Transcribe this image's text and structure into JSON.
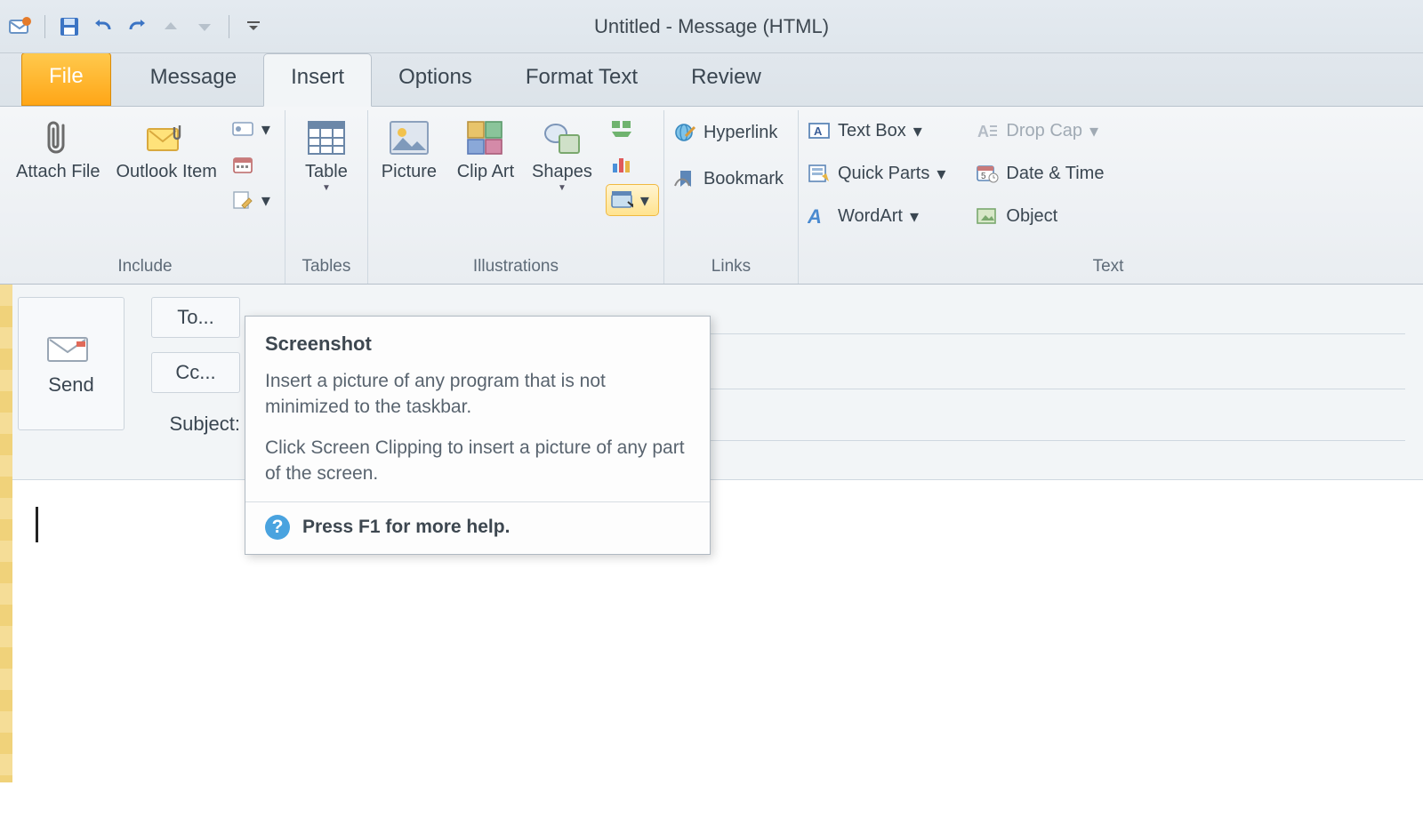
{
  "window": {
    "title": "Untitled  -  Message (HTML)"
  },
  "qat_icons": [
    "outlook-icon",
    "save-icon",
    "undo-icon",
    "redo-icon",
    "prev-icon",
    "next-icon",
    "customize-icon"
  ],
  "tabs": {
    "file": "File",
    "items": [
      "Message",
      "Insert",
      "Options",
      "Format Text",
      "Review"
    ],
    "active": "Insert"
  },
  "ribbon": {
    "groups": [
      {
        "name": "Include",
        "big": [
          {
            "id": "attach-file",
            "label": "Attach\nFile",
            "icon": "paperclip-icon"
          },
          {
            "id": "outlook-item",
            "label": "Outlook\nItem",
            "icon": "envelope-paperclip-icon"
          }
        ],
        "small": [
          {
            "id": "business-card",
            "icon": "business-card-icon",
            "dropdown": true
          },
          {
            "id": "calendar",
            "icon": "calendar-icon"
          },
          {
            "id": "signature",
            "icon": "signature-icon",
            "dropdown": true
          }
        ]
      },
      {
        "name": "Tables",
        "big": [
          {
            "id": "table",
            "label": "Table",
            "icon": "table-icon",
            "dropdown": true
          }
        ]
      },
      {
        "name": "Illustrations",
        "big": [
          {
            "id": "picture",
            "label": "Picture",
            "icon": "picture-icon"
          },
          {
            "id": "clip-art",
            "label": "Clip\nArt",
            "icon": "clipart-icon"
          },
          {
            "id": "shapes",
            "label": "Shapes",
            "icon": "shapes-icon",
            "dropdown": true
          }
        ],
        "small": [
          {
            "id": "smartart",
            "icon": "smartart-icon"
          },
          {
            "id": "chart",
            "icon": "chart-icon"
          },
          {
            "id": "screenshot",
            "icon": "screenshot-icon",
            "dropdown": true,
            "highlighted": true
          }
        ]
      },
      {
        "name": "Links",
        "rows": [
          {
            "id": "hyperlink",
            "label": "Hyperlink",
            "icon": "hyperlink-icon"
          },
          {
            "id": "bookmark",
            "label": "Bookmark",
            "icon": "bookmark-icon"
          }
        ]
      },
      {
        "name": "Text",
        "col1": [
          {
            "id": "text-box",
            "label": "Text Box",
            "icon": "textbox-icon",
            "dropdown": true
          },
          {
            "id": "quick-parts",
            "label": "Quick Parts",
            "icon": "quickparts-icon",
            "dropdown": true
          },
          {
            "id": "wordart",
            "label": "WordArt",
            "icon": "wordart-icon",
            "dropdown": true
          }
        ],
        "col2": [
          {
            "id": "drop-cap",
            "label": "Drop Cap",
            "icon": "dropcap-icon",
            "dropdown": true,
            "disabled": true
          },
          {
            "id": "date-time",
            "label": "Date & Time",
            "icon": "datetime-icon"
          },
          {
            "id": "object",
            "label": "Object",
            "icon": "object-icon"
          }
        ]
      }
    ]
  },
  "compose": {
    "send": "Send",
    "to": "To...",
    "cc": "Cc...",
    "subject": "Subject:"
  },
  "tooltip": {
    "title": "Screenshot",
    "p1": "Insert a picture of any program that is not minimized to the taskbar.",
    "p2": "Click Screen Clipping to insert a picture of any part of the screen.",
    "help": "Press F1 for more help."
  }
}
